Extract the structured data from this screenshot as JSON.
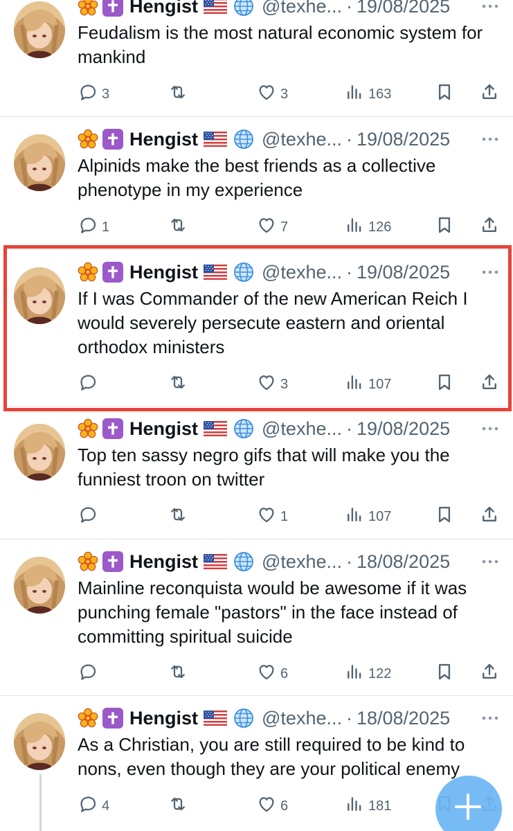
{
  "colors": {
    "text": "#0f1419",
    "muted": "#536471",
    "highlight_border": "#e5443a",
    "fab": "#6cb6f5",
    "cross_badge": "#9b59c9"
  },
  "tweets": [
    {
      "name": "Hengist",
      "handle": "@texhe...",
      "separator": "·",
      "date": "19/08/2025",
      "text": "Feudalism is the most natural economic system for mankind",
      "replies": "3",
      "retweets": "",
      "likes": "3",
      "views": "163"
    },
    {
      "name": "Hengist",
      "handle": "@texhe...",
      "separator": "·",
      "date": "19/08/2025",
      "text": "Alpinids make the best friends as a collective phenotype in my experience",
      "replies": "1",
      "retweets": "",
      "likes": "7",
      "views": "126"
    },
    {
      "name": "Hengist",
      "handle": "@texhe...",
      "separator": "·",
      "date": "19/08/2025",
      "text": "If I was Commander of the new American Reich I would severely persecute eastern and oriental orthodox ministers",
      "replies": "",
      "retweets": "",
      "likes": "3",
      "views": "107"
    },
    {
      "name": "Hengist",
      "handle": "@texhe...",
      "separator": "·",
      "date": "19/08/2025",
      "text": "Top ten sassy negro gifs that will make you the funniest troon on twitter",
      "replies": "",
      "retweets": "",
      "likes": "1",
      "views": "107"
    },
    {
      "name": "Hengist",
      "handle": "@texhe...",
      "separator": "·",
      "date": "18/08/2025",
      "text": "Mainline reconquista would be awesome if it was punching female \"pastors\" in the face instead of committing spiritual suicide",
      "replies": "",
      "retweets": "",
      "likes": "6",
      "views": "122"
    },
    {
      "name": "Hengist",
      "handle": "@texhe...",
      "separator": "·",
      "date": "18/08/2025",
      "text": "As a Christian, you are still required to be kind to nons, even though they are your political enemy",
      "replies": "4",
      "retweets": "",
      "likes": "6",
      "views": "181"
    }
  ],
  "icons": {
    "badge_1": "flower-icon",
    "badge_2": "cross-icon",
    "flag": "us-flag-icon",
    "globe": "globe-icon",
    "more": "more-icon",
    "reply": "reply-icon",
    "retweet": "retweet-icon",
    "like": "heart-icon",
    "views": "views-icon",
    "bookmark": "bookmark-icon",
    "share": "share-icon",
    "compose": "compose-plus-icon"
  }
}
